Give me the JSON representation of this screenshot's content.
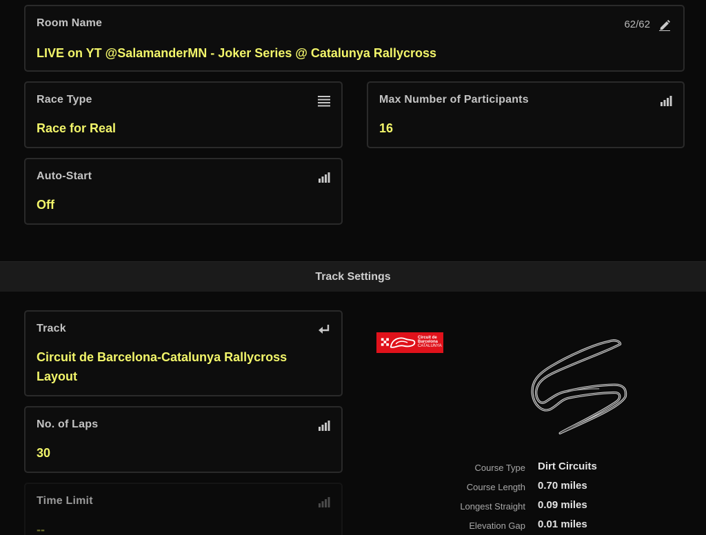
{
  "room": {
    "label": "Room Name",
    "value": "LIVE on YT @SalamanderMN - Joker Series @ Catalunya Rallycross",
    "counter": "62/62",
    "icon": "pencil-icon"
  },
  "race_type": {
    "label": "Race Type",
    "value": "Race for Real",
    "icon": "list-icon"
  },
  "max_participants": {
    "label": "Max Number of Participants",
    "value": "16",
    "icon": "signal-bars-icon"
  },
  "auto_start": {
    "label": "Auto-Start",
    "value": "Off",
    "icon": "signal-bars-icon"
  },
  "track_settings": {
    "title": "Track Settings"
  },
  "track": {
    "label": "Track",
    "value_line1": "Circuit de Barcelona-Catalunya Rallycross",
    "value_line2": "Layout",
    "icon": "enter-arrow-icon"
  },
  "laps": {
    "label": "No. of Laps",
    "value": "30",
    "icon": "signal-bars-icon"
  },
  "time_limit": {
    "label": "Time Limit",
    "value": "--",
    "icon": "signal-bars-icon"
  },
  "logo": {
    "line1": "Circuit de",
    "line2": "Barcelona",
    "line3": "CATALUNYA"
  },
  "track_info": [
    {
      "label": "Course Type",
      "value": "Dirt Circuits"
    },
    {
      "label": "Course Length",
      "value": "0.70 miles"
    },
    {
      "label": "Longest Straight",
      "value": "0.09 miles"
    },
    {
      "label": "Elevation Gap",
      "value": "0.01 miles"
    }
  ],
  "colors": {
    "accent_yellow": "#f2f56a",
    "logo_red": "#e0121b"
  }
}
